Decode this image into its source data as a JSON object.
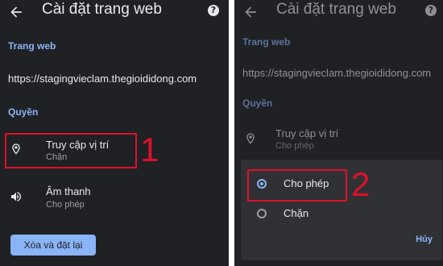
{
  "left": {
    "header": {
      "title": "Cài đặt trang web",
      "back_icon": "back-arrow-icon",
      "help_icon": "help-icon"
    },
    "site_section_label": "Trang web",
    "site_url": "https://stagingvieclam.thegioididong.com",
    "permissions_section_label": "Quyền",
    "permissions": [
      {
        "title": "Truy cập vị trí",
        "status": "Chặn",
        "icon": "location-pin-icon"
      },
      {
        "title": "Âm thanh",
        "status": "Cho phép",
        "icon": "speaker-icon"
      }
    ],
    "reset_button_label": "Xóa và đặt lại",
    "annotation_number": "1"
  },
  "right": {
    "header": {
      "title": "Cài đặt trang web",
      "back_icon": "back-arrow-icon",
      "help_icon": "help-icon"
    },
    "site_section_label": "Trang web",
    "site_url": "https://stagingvieclam.thegioididong.com",
    "permissions_section_label": "Quyền",
    "permission": {
      "title": "Truy cập vị trí",
      "status": "Cho phép",
      "icon": "location-pin-icon"
    },
    "dialog": {
      "options": [
        {
          "label": "Cho phép",
          "selected": true
        },
        {
          "label": "Chặn",
          "selected": false
        }
      ],
      "cancel_label": "Hủy"
    },
    "annotation_number": "2"
  },
  "colors": {
    "background": "#202124",
    "accent": "#8ab4f8",
    "annotation": "#e0102a",
    "text_primary": "#e8eaed",
    "text_secondary": "#9aa0a6"
  }
}
